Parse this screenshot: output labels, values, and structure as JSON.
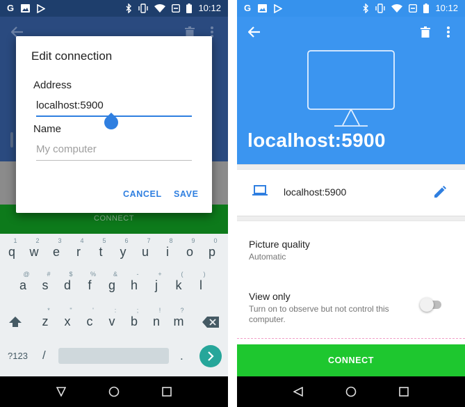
{
  "status": {
    "time": "10:12",
    "left_glyphs": [
      "G",
      "photo-icon",
      "play-store-icon"
    ],
    "right_icons": [
      "bluetooth-icon",
      "vibrate-icon",
      "wifi-icon",
      "dnd-icon",
      "battery-icon"
    ]
  },
  "left": {
    "dialog": {
      "title": "Edit connection",
      "address_label": "Address",
      "address_value": "localhost:5900",
      "name_label": "Name",
      "name_placeholder": "My computer",
      "cancel": "CANCEL",
      "save": "SAVE"
    },
    "background_connect": "CONNECT",
    "keyboard": {
      "row1": [
        {
          "k": "q",
          "h": "1"
        },
        {
          "k": "w",
          "h": "2"
        },
        {
          "k": "e",
          "h": "3"
        },
        {
          "k": "r",
          "h": "4"
        },
        {
          "k": "t",
          "h": "5"
        },
        {
          "k": "y",
          "h": "6"
        },
        {
          "k": "u",
          "h": "7"
        },
        {
          "k": "i",
          "h": "8"
        },
        {
          "k": "o",
          "h": "9"
        },
        {
          "k": "p",
          "h": "0"
        }
      ],
      "row2": [
        {
          "k": "a",
          "h": "@"
        },
        {
          "k": "s",
          "h": "#"
        },
        {
          "k": "d",
          "h": "$"
        },
        {
          "k": "f",
          "h": "%"
        },
        {
          "k": "g",
          "h": "&"
        },
        {
          "k": "h",
          "h": "-"
        },
        {
          "k": "j",
          "h": "+"
        },
        {
          "k": "k",
          "h": "("
        },
        {
          "k": "l",
          "h": ")"
        }
      ],
      "row3": [
        {
          "k": "z",
          "h": "*"
        },
        {
          "k": "x",
          "h": "\""
        },
        {
          "k": "c",
          "h": "'"
        },
        {
          "k": "v",
          "h": ":"
        },
        {
          "k": "b",
          "h": ";"
        },
        {
          "k": "n",
          "h": "!"
        },
        {
          "k": "m",
          "h": "?"
        }
      ],
      "symbols_key": "?123",
      "slash_key": "/",
      "period_key": "."
    }
  },
  "right": {
    "host_title": "localhost:5900",
    "address_row": "localhost:5900",
    "picture_quality_title": "Picture quality",
    "picture_quality_value": "Automatic",
    "view_only_title": "View only",
    "view_only_desc_line1": "Turn on to observe but not control this",
    "view_only_desc_line2": "computer.",
    "view_only_enabled": false,
    "connect": "CONNECT"
  },
  "colors": {
    "accent_blue": "#3b95f0",
    "connect_green": "#1ec72f",
    "enter_teal": "#26a69a"
  }
}
